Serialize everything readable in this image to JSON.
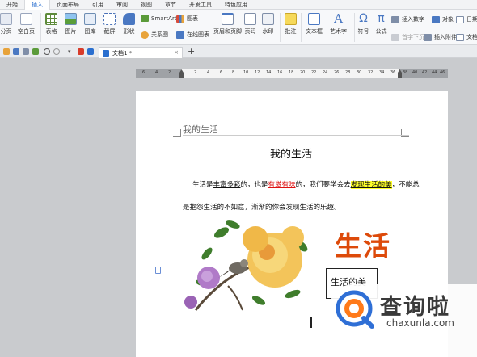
{
  "ribbon_tabs": [
    "开始",
    "插入",
    "页面布局",
    "引用",
    "审阅",
    "视图",
    "章节",
    "开发工具",
    "特色应用"
  ],
  "active_tab": "插入",
  "ribbon": {
    "cover_page": "分页",
    "blank_page": "空白页",
    "table": "表格",
    "picture": "图片",
    "gallery": "图库",
    "screenshot": "截屏",
    "shapes": "形状",
    "smartart": "SmartArt",
    "chart": "图表",
    "relation_graph": "关系图",
    "online_chart": "在线图表",
    "header_footer": "页眉和页脚",
    "page_number": "页码",
    "watermark": "水印",
    "comment": "批注",
    "textbox": "文本框",
    "wordart": "艺术字",
    "symbol": "符号",
    "formula": "公式",
    "insert_number": "插入数字",
    "object": "对象",
    "date": "日期",
    "first_drop": "首字下沉",
    "attachment": "插入附件",
    "doc_parts": "文档部"
  },
  "doc_tab": {
    "name": "文档1 *"
  },
  "new_tab_symbol": "+",
  "ruler_numbers": [
    "6",
    "4",
    "2",
    "2",
    "4",
    "6",
    "8",
    "10",
    "12",
    "14",
    "16",
    "18",
    "20",
    "22",
    "24",
    "26",
    "28",
    "30",
    "32",
    "34",
    "36",
    "38",
    "40",
    "42",
    "44",
    "46"
  ],
  "document": {
    "header_text": "我的生活",
    "title": "我的生活",
    "para1": {
      "t1": "生活是",
      "u1": "丰富多彩",
      "t2": "的，也是",
      "u2": "有滋有味",
      "t3": "的，我们要学会去",
      "hl": "发现生活的美",
      "t4": "，不能总"
    },
    "para2": "是抱怨生活的不如意，渐渐的你会发现生活的乐趣。",
    "wordart": "生活",
    "textbox": "生活的美"
  },
  "watermark": {
    "cn": "查询啦",
    "en": "chaxunla.com"
  },
  "colors": {
    "active_tab": "#2a6fcf",
    "wordart": "#dd4a0a",
    "highlight": "#ffff29",
    "red_underline": "#d11111"
  }
}
